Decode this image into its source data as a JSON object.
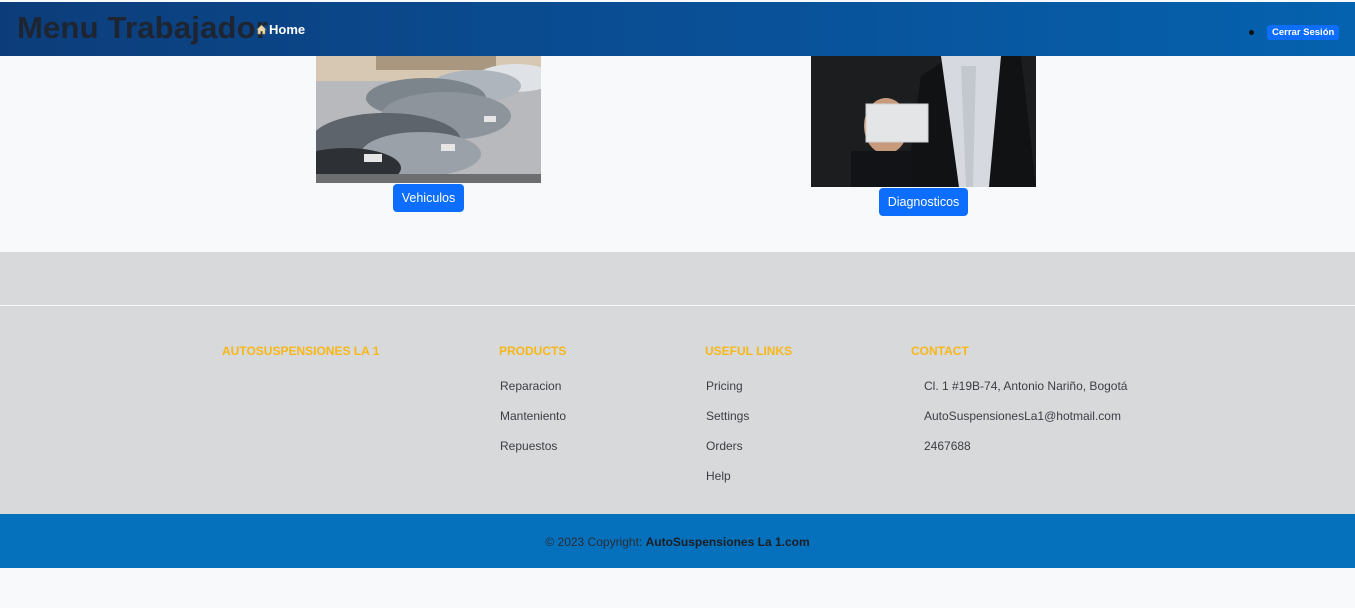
{
  "navbar": {
    "brand": "Menu Trabajador",
    "home_label": "Home",
    "logout_label": "Cerrar Sesión"
  },
  "cards": {
    "vehicles_button": "Vehiculos",
    "diagnostics_button": "Diagnosticos"
  },
  "footer": {
    "company_title": "AUTOSUSPENSIONES LA 1",
    "products": {
      "title": "PRODUCTS",
      "items": [
        "Reparacion",
        "Manteniento",
        "Repuestos"
      ]
    },
    "useful_links": {
      "title": "USEFUL LINKS",
      "items": [
        "Pricing",
        "Settings",
        "Orders",
        "Help"
      ]
    },
    "contact": {
      "title": "CONTACT",
      "address": "Cl. 1 #19B-74, Antonio Nariño, Bogotá",
      "email": "AutoSuspensionesLa1@hotmail.com",
      "phone": "2467688"
    },
    "copyright_prefix": "© 2023 Copyright:",
    "copyright_brand": "AutoSuspensiones La 1.com"
  },
  "colors": {
    "navbar_start": "#0c3d7a",
    "navbar_end": "#0562ae",
    "primary_button": "#0d6efd",
    "footer_bg": "#d8d9db",
    "footer_heading": "#f7b718",
    "bottom_bar": "#0571bd"
  }
}
